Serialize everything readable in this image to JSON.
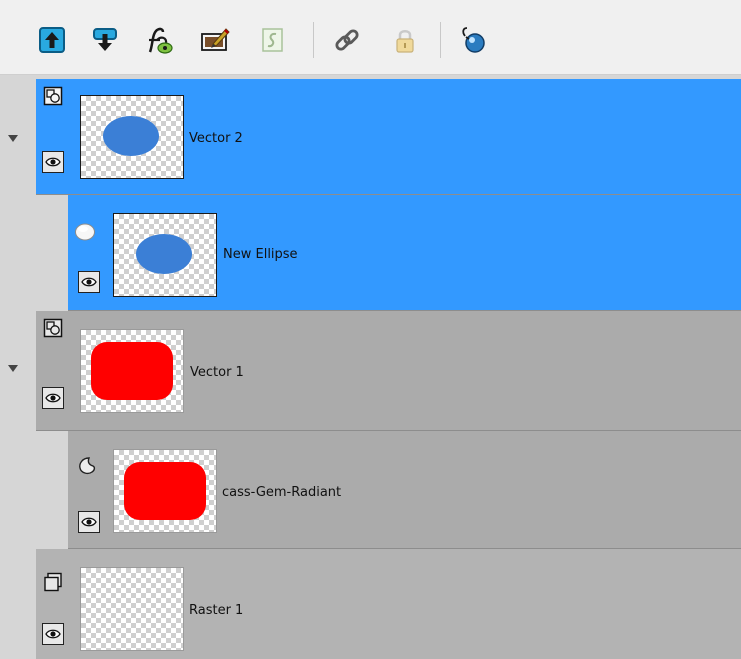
{
  "toolbar": {
    "buttons": [
      {
        "name": "move-layer-up-icon"
      },
      {
        "name": "move-layer-down-icon"
      },
      {
        "name": "layer-effects-icon"
      },
      {
        "name": "edit-layer-icon"
      },
      {
        "name": "script-icon"
      },
      {
        "name": "link-icon"
      },
      {
        "name": "lock-icon"
      },
      {
        "name": "pin-icon"
      }
    ]
  },
  "colors": {
    "selected_row": "#3399ff",
    "normal_row": "#ababab",
    "ellipse_fill": "#3b7fd6",
    "rect_fill": "#ff0000"
  },
  "layers": [
    {
      "label": "Vector 2",
      "type": "vector-group",
      "selected": true,
      "expanded": true,
      "shape": "ellipse",
      "shape_color": "#3b7fd6"
    },
    {
      "label": "New Ellipse",
      "type": "ellipse-object",
      "selected": true,
      "shape": "ellipse",
      "shape_color": "#3b7fd6"
    },
    {
      "label": "Vector 1",
      "type": "vector-group",
      "selected": false,
      "expanded": true,
      "shape": "rounded-rect",
      "shape_color": "#ff0000"
    },
    {
      "label": "cass-Gem-Radiant",
      "type": "preset-shape-object",
      "selected": false,
      "shape": "rounded-rect",
      "shape_color": "#ff0000"
    },
    {
      "label": "Raster 1",
      "type": "raster",
      "selected": false,
      "shape": "none"
    }
  ]
}
